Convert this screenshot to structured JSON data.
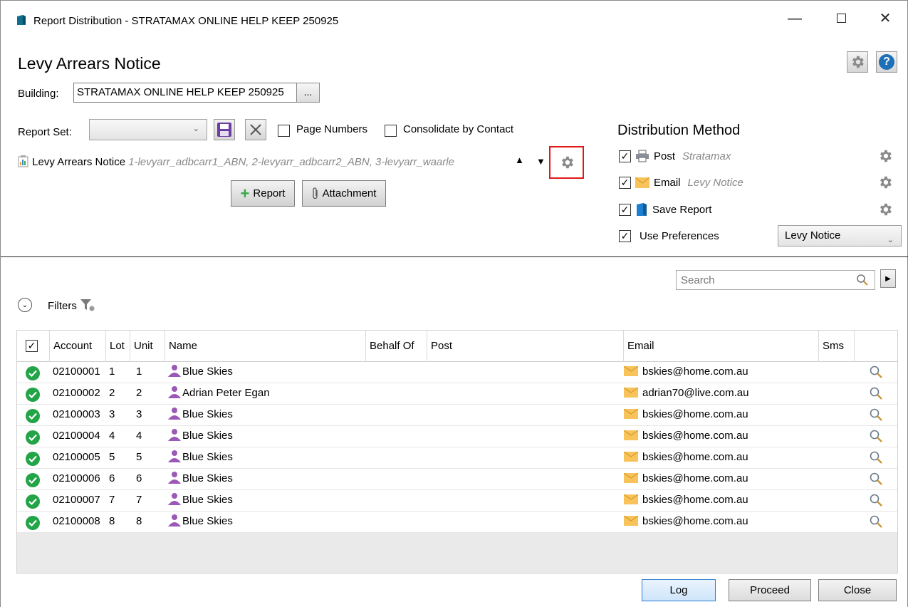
{
  "window": {
    "title": "Report Distribution - STRATAMAX ONLINE HELP KEEP 250925"
  },
  "page": {
    "heading": "Levy Arrears Notice"
  },
  "building": {
    "label": "Building:",
    "value": "STRATAMAX ONLINE HELP KEEP 250925",
    "browse_label": "..."
  },
  "report_set": {
    "label": "Report Set:",
    "selected": "",
    "page_numbers_label": "Page Numbers",
    "page_numbers_checked": false,
    "consolidate_label": "Consolidate by Contact",
    "consolidate_checked": false
  },
  "report_item": {
    "name": "Levy Arrears Notice",
    "detail": "1-levyarr_adbcarr1_ABN, 2-levyarr_adbcarr2_ABN, 3-levyarr_waarle"
  },
  "buttons": {
    "add_report": "Report",
    "attachment": "Attachment"
  },
  "distribution": {
    "title": "Distribution Method",
    "post": {
      "label": "Post",
      "hint": "Stratamax",
      "checked": true
    },
    "email": {
      "label": "Email",
      "hint": "Levy Notice",
      "checked": true
    },
    "save": {
      "label": "Save Report",
      "checked": true
    },
    "preferences": {
      "label": "Use Preferences",
      "checked": true,
      "selected": "Levy Notice"
    }
  },
  "search": {
    "placeholder": "Search"
  },
  "filters": {
    "label": "Filters"
  },
  "grid": {
    "columns": [
      "Account",
      "Lot",
      "Unit",
      "Name",
      "Behalf Of",
      "Post",
      "Email",
      "Sms"
    ],
    "rows": [
      {
        "account": "02100001",
        "lot": "1",
        "unit": "1",
        "name": "Blue Skies",
        "email": "bskies@home.com.au"
      },
      {
        "account": "02100002",
        "lot": "2",
        "unit": "2",
        "name": "Adrian Peter Egan",
        "email": "adrian70@live.com.au"
      },
      {
        "account": "02100003",
        "lot": "3",
        "unit": "3",
        "name": "Blue Skies",
        "email": "bskies@home.com.au"
      },
      {
        "account": "02100004",
        "lot": "4",
        "unit": "4",
        "name": "Blue Skies",
        "email": "bskies@home.com.au"
      },
      {
        "account": "02100005",
        "lot": "5",
        "unit": "5",
        "name": "Blue Skies",
        "email": "bskies@home.com.au"
      },
      {
        "account": "02100006",
        "lot": "6",
        "unit": "6",
        "name": "Blue Skies",
        "email": "bskies@home.com.au"
      },
      {
        "account": "02100007",
        "lot": "7",
        "unit": "7",
        "name": "Blue Skies",
        "email": "bskies@home.com.au"
      },
      {
        "account": "02100008",
        "lot": "8",
        "unit": "8",
        "name": "Blue Skies",
        "email": "bskies@home.com.au"
      }
    ]
  },
  "footer": {
    "log": "Log",
    "proceed": "Proceed",
    "close": "Close"
  },
  "colors": {
    "accent": "#1d6fb8",
    "ok": "#22a447",
    "contact": "#9b59b6",
    "highlight": "#e01818"
  }
}
